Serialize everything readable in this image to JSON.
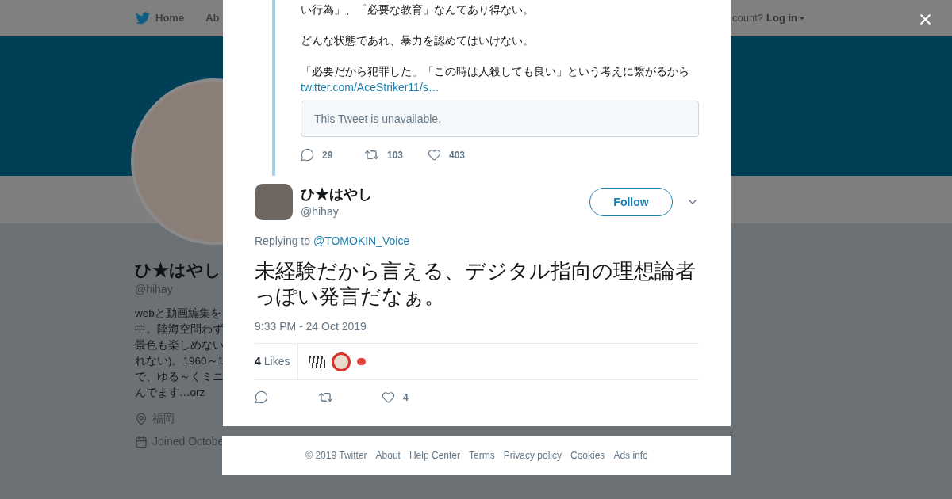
{
  "background": {
    "nav": {
      "items": [
        "Home",
        "Ab"
      ],
      "account_prompt": "count?",
      "login": "Log in"
    },
    "profile": {
      "name": "ひ★はやし",
      "handle": "@hihay",
      "bio": [
        "webと動画編集を",
        "中。陸海空問わず",
        "景色も楽しめない",
        "れない)。1960～1",
        "で、ゆる～くミニ",
        "んでます…orz"
      ],
      "location": "福岡",
      "joined": "Joined Octobe"
    }
  },
  "quoted_tail": {
    "paragraphs": [
      "い行為」、「必要な教育」なんてあり得ない。",
      "どんな状態であれ、暴力を認めてはいけない。",
      "「必要だから犯罪した」「この時は人殺しても良い」という考えに繋がるから"
    ],
    "link": "twitter.com/AceStriker11/s…",
    "embedded": "This Tweet is unavailable.",
    "actions": [
      {
        "kind": "reply",
        "count": "29"
      },
      {
        "kind": "retweet",
        "count": "103"
      },
      {
        "kind": "like",
        "count": "403"
      }
    ]
  },
  "tweet": {
    "name": "ひ★はやし",
    "handle": "@hihay",
    "follow": "Follow",
    "replying_label": "Replying to",
    "replying_to": "@TOMOKIN_Voice",
    "text": "未経験だから言える、デジタル指向の理想論者っぽい発言だなぁ。",
    "time": "9:33 PM - 24 Oct 2019",
    "likes_count": "4",
    "likes_label": "Likes",
    "likers": [
      {
        "kind": "text-logo"
      },
      {
        "kind": "round"
      },
      {
        "kind": "emoji"
      }
    ],
    "actions": [
      {
        "kind": "reply"
      },
      {
        "kind": "retweet"
      },
      {
        "kind": "like",
        "count": "4"
      }
    ]
  },
  "footer": [
    "© 2019 Twitter",
    "About",
    "Help Center",
    "Terms",
    "Privacy policy",
    "Cookies",
    "Ads info"
  ]
}
